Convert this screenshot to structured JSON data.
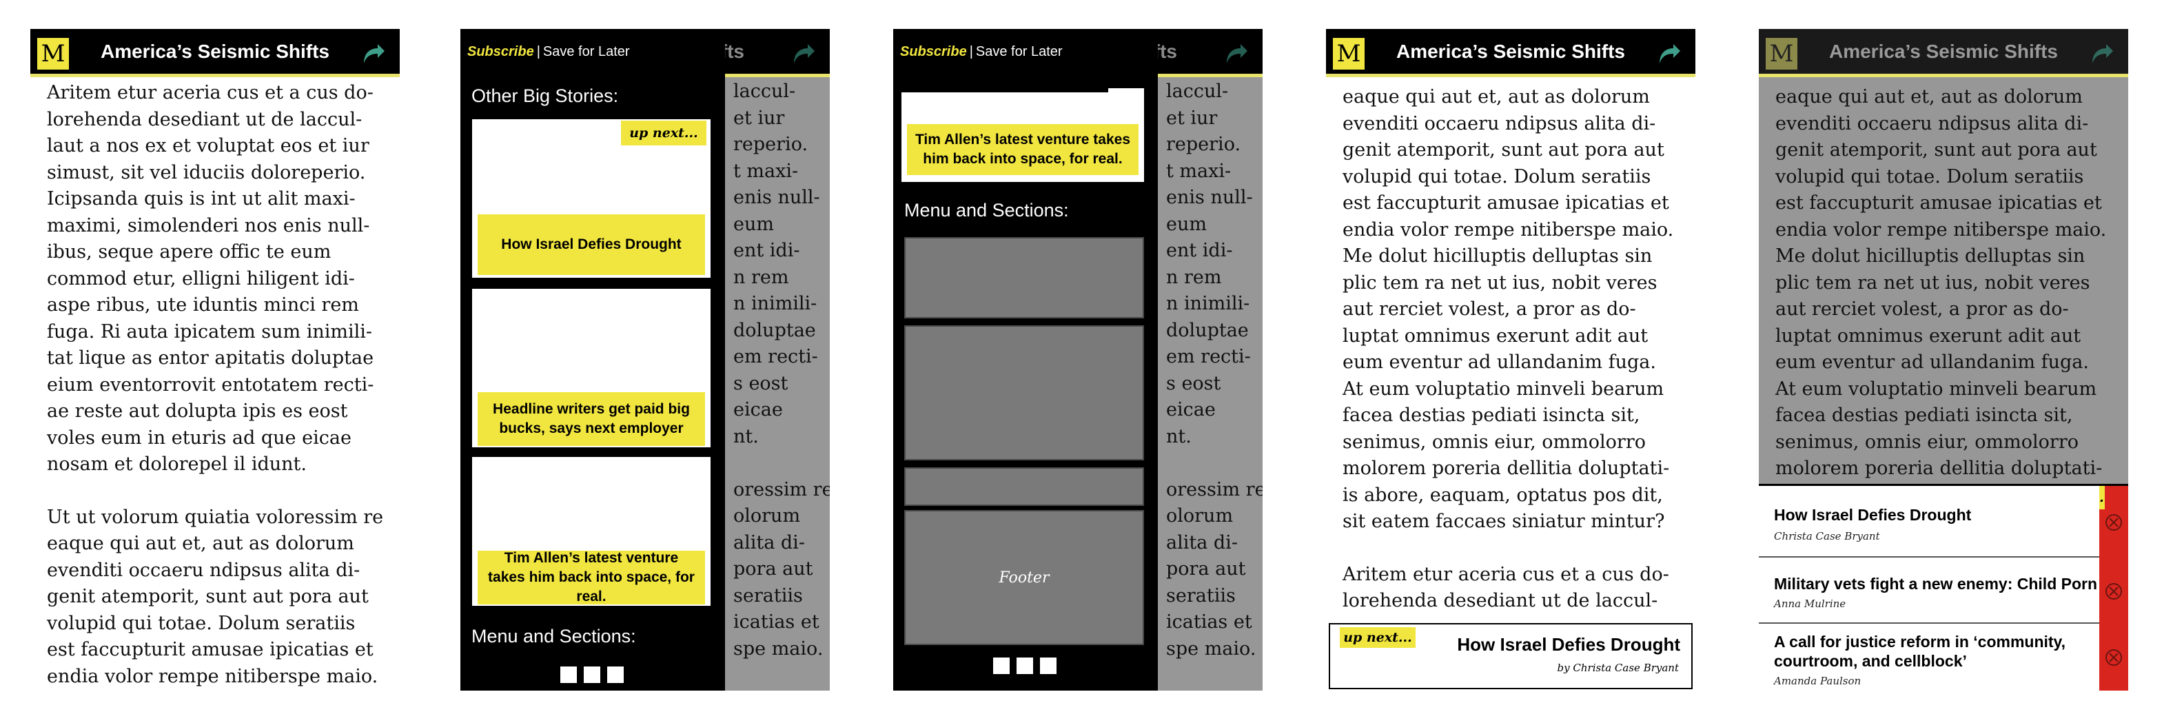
{
  "header": {
    "logo": "M",
    "title": "America’s Seismic Shifts",
    "title_partial": "ifts"
  },
  "colors": {
    "accent": "#f1e63f",
    "bar": "#000000",
    "dim": "#979797",
    "red": "#d8261f"
  },
  "article": {
    "para1_lines": [
      "Aritem etur aceria cus et a cus do-",
      "lorehenda desediant ut de laccul-",
      "laut a nos ex et voluptat eos et iur",
      "simust, sit vel iduciis doloreperio.",
      "Icipsanda quis is int ut alit maxi-",
      "maximi, simolenderi nos enis null-",
      "ibus, seque apere offic te eum",
      "commod etur, elligni hiligent idi-",
      "aspe ribus, ute iduntis minci rem",
      "fuga. Ri auta ipicatem sum inimili-",
      "tat lique as entor apitatis doluptae",
      "eium eventorrovit entotatem recti-",
      "ae reste aut dolupta ipis es eost",
      "voles eum in eturis ad que eicae",
      "nosam et dolorepel il idunt."
    ],
    "para2_lines": [
      "Ut ut volorum quiatia voloressim re",
      "eaque qui aut et, aut as dolorum",
      "evenditi occaeru ndipsus alita di-",
      "genit atemporit, sunt aut pora aut",
      "volupid qui totae. Dolum seratiis",
      "est faccupturit amusae ipicatias et",
      "endia volor rempe nitiberspe maio."
    ],
    "para2_cont_lines": [
      "Me dolut hicilluptis delluptas sin",
      "plic tem ra net ut ius, nobit veres",
      "aut rerciet volest, a pror as do-",
      "luptat omnimus exerunt adit aut",
      "eum eventur ad ullandanim fuga.",
      "At eum voluptatio minveli bearum",
      "facea destias pediati isincta sit,",
      "senimus, omnis eiur, ommolorro",
      "molorem poreria dellitia doluptati-",
      "is abore, eaquam, optatus pos dit,",
      "sit eatem faccaes siniatur mintur?"
    ],
    "para3_lines": [
      "Aritem etur aceria cus et a cus do-",
      "lorehenda desediant ut de laccul-"
    ],
    "peek_lines": [
      "laccul-",
      "et iur",
      "reperio.",
      "t maxi-",
      "enis null-",
      "eum",
      "ent idi-",
      "n rem",
      "n inimili-",
      "doluptae",
      "em recti-",
      "s eost",
      "eicae",
      "nt.",
      "",
      "oressim re",
      "olorum",
      "alita di-",
      "pora aut",
      "seratiis",
      "icatias et",
      "spe maio."
    ]
  },
  "menu": {
    "subscribe": "Subscribe",
    "separator": "|",
    "save_later": "Save for Later",
    "other_stories_heading": "Other Big Stories:",
    "up_next": "up next...",
    "stories": [
      "How Israel Defies Drought",
      "Headline writers get paid big bucks, says next employer",
      "Tim Allen’s latest venture takes him back into space, for real."
    ],
    "menu_heading": "Menu and Sections:",
    "footer": "Footer"
  },
  "upnext_bar": {
    "label": "up next...",
    "title": "How Israel Defies Drought",
    "byline": "by Christa Case Bryant"
  },
  "story_list": [
    {
      "title": "How Israel Defies Drought",
      "author": "Christa Case Bryant"
    },
    {
      "title": "Military vets fight a new enemy: Child Porn",
      "author": "Anna Mulrine"
    },
    {
      "title": "A call for justice reform in ‘community, courtroom, and cellblock’",
      "author": "Amanda Paulson"
    }
  ]
}
